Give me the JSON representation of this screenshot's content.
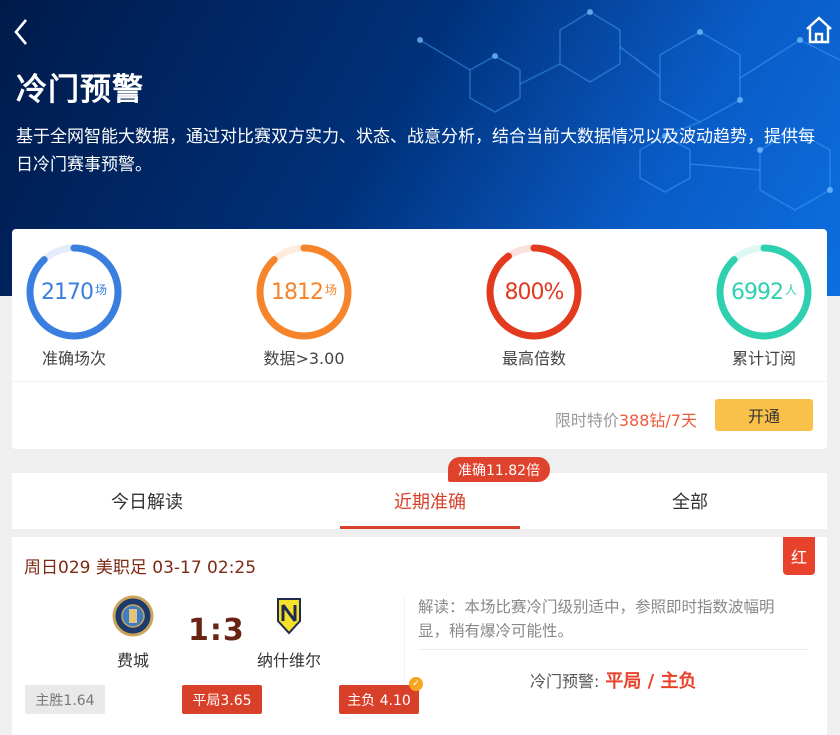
{
  "header": {
    "title": "冷门预警",
    "description": "基于全网智能大数据，通过对比赛双方实力、状态、战意分析，结合当前大数据情况以及波动趋势，提供每日冷门赛事预警。"
  },
  "stats": [
    {
      "value": "2170",
      "unit": "场",
      "label": "准确场次",
      "color": "#3a7fe0",
      "progress": 0.88
    },
    {
      "value": "1812",
      "unit": "场",
      "label": "数据>3.00",
      "color": "#f5842a",
      "progress": 0.88
    },
    {
      "value": "800%",
      "unit": "",
      "label": "最高倍数",
      "color": "#e2391f",
      "progress": 0.9
    },
    {
      "value": "6992",
      "unit": "人",
      "label": "累计订阅",
      "color": "#2fd0b0",
      "progress": 0.88
    }
  ],
  "promo": {
    "prefix": "限时特价",
    "price": "388钻/7天",
    "button": "开通"
  },
  "tabs": [
    {
      "label": "今日解读"
    },
    {
      "label": "近期准确"
    },
    {
      "label": "全部"
    }
  ],
  "tab_badge": "准确11.82倍",
  "match": {
    "title": "周日029 美职足 03-17 02:25",
    "result_tag": "红",
    "home": "费城",
    "away": "纳什维尔",
    "score": "1:3",
    "analysis": "解读：本场比赛冷门级别适中，参照即时指数波幅明显，稍有爆冷可能性。",
    "warning_label": "冷门预警:",
    "warning_result": "平局 / 主负",
    "odds": [
      "主胜1.64",
      "平局3.65",
      "主负 4.10"
    ]
  }
}
